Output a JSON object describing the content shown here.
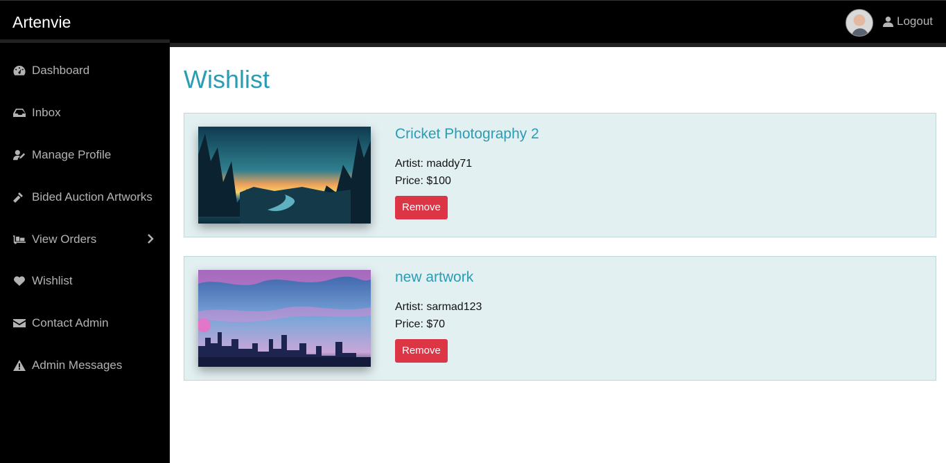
{
  "app": {
    "brand": "Artenvie"
  },
  "header": {
    "logout_label": "Logout"
  },
  "sidebar": {
    "items": [
      {
        "label": "Dashboard",
        "icon": "dashboard-icon"
      },
      {
        "label": "Inbox",
        "icon": "inbox-icon"
      },
      {
        "label": "Manage Profile",
        "icon": "user-edit-icon"
      },
      {
        "label": "Bided Auction Artworks",
        "icon": "gavel-icon"
      },
      {
        "label": "View Orders",
        "icon": "dolly-icon"
      },
      {
        "label": "Wishlist",
        "icon": "heart-icon"
      },
      {
        "label": "Contact Admin",
        "icon": "envelope-icon"
      },
      {
        "label": "Admin Messages",
        "icon": "warning-icon"
      }
    ]
  },
  "main": {
    "title": "Wishlist",
    "items": [
      {
        "title": "Cricket Photography 2",
        "artist": "Artist: maddy71",
        "price": "Price: $100",
        "remove_label": "Remove"
      },
      {
        "title": "new artwork",
        "artist": "Artist: sarmad123",
        "price": "Price: $70",
        "remove_label": "Remove"
      }
    ]
  },
  "colors": {
    "accent": "#2a9cb4",
    "danger": "#dc3545",
    "card_bg": "#e3f0f2",
    "sidebar_bg": "#000000"
  }
}
